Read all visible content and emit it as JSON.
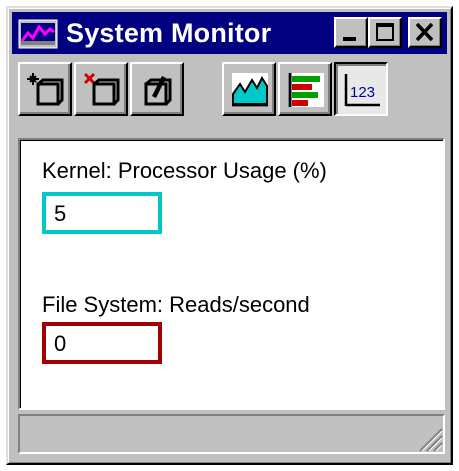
{
  "window": {
    "title": "System Monitor"
  },
  "icons": {
    "app": "system-monitor-icon",
    "minimize": "minimize-icon",
    "maximize": "maximize-icon",
    "close": "close-icon",
    "toolbar": [
      "new-icon",
      "remove-icon",
      "edit-icon",
      "line-chart-icon",
      "bar-chart-icon",
      "numeric-123-icon"
    ]
  },
  "toolbar": {
    "numeric_label": "123"
  },
  "counters": [
    {
      "label": "Kernel: Processor Usage (%)",
      "value": "5",
      "color": "#00c8c8"
    },
    {
      "label": "File System: Reads/second",
      "value": "0",
      "color": "#a00000"
    }
  ],
  "statusbar": {
    "text": ""
  }
}
